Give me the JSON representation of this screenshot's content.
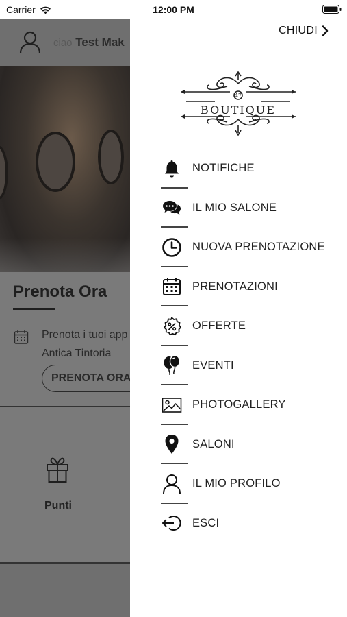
{
  "status_bar": {
    "carrier": "Carrier",
    "time": "12:00 PM"
  },
  "background": {
    "greeting_prefix": "ciao",
    "user_name": "Test Mak",
    "section_title": "Prenota Ora",
    "description_line1": "Prenota i tuoi app",
    "description_line2": "Antica Tintoria",
    "book_button": "PRENOTA ORA",
    "points_label": "Punti"
  },
  "drawer": {
    "close_label": "CHIUDI",
    "logo_text": "BOUTIQUE",
    "logo_number": "47",
    "menu": [
      {
        "label": "NOTIFICHE",
        "icon": "bell-icon"
      },
      {
        "label": "IL MIO SALONE",
        "icon": "chat-bubbles-icon"
      },
      {
        "label": "NUOVA PRENOTAZIONE",
        "icon": "clock-icon"
      },
      {
        "label": "PRENOTAZIONI",
        "icon": "calendar-icon"
      },
      {
        "label": "OFFERTE",
        "icon": "discount-badge-icon"
      },
      {
        "label": "EVENTI",
        "icon": "balloons-icon"
      },
      {
        "label": "PHOTOGALLERY",
        "icon": "image-icon"
      },
      {
        "label": "SALONI",
        "icon": "map-pin-icon"
      },
      {
        "label": "IL MIO PROFILO",
        "icon": "user-icon"
      },
      {
        "label": "ESCI",
        "icon": "logout-icon"
      }
    ]
  },
  "colors": {
    "overlay": "#7a7a7a",
    "drawer_bg": "#ffffff",
    "text": "#222222"
  }
}
